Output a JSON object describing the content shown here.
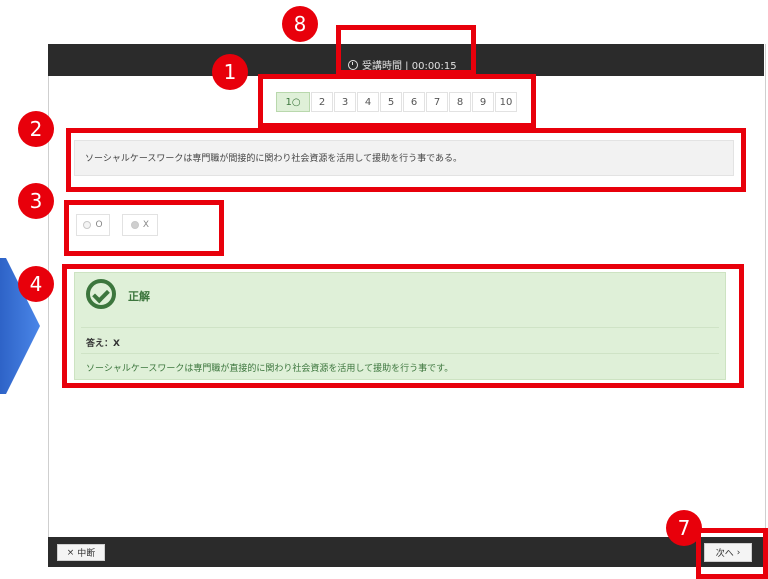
{
  "timer": {
    "label": "受講時間 | 00:00:15"
  },
  "pager": {
    "items": [
      "1○",
      "2",
      "3",
      "4",
      "5",
      "6",
      "7",
      "8",
      "9",
      "10"
    ],
    "active_index": 0
  },
  "question": {
    "text": "ソーシャルケースワークは専門職が間接的に関わり社会資源を活用して援助を行う事である。"
  },
  "options": [
    {
      "label": "O",
      "selected": false
    },
    {
      "label": "X",
      "selected": true
    }
  ],
  "result": {
    "status": "正解",
    "answer": "答え：X",
    "explanation": "ソーシャルケースワークは専門職が直接的に関わり社会資源を活用して援助を行う事です。"
  },
  "footer": {
    "stop_label": "中断",
    "stop_icon": "×",
    "next_label": "次へ",
    "next_icon": "›"
  },
  "annotations": {
    "b1": "1",
    "b2": "2",
    "b3": "3",
    "b4": "4",
    "b7": "7",
    "b8": "8"
  },
  "colors": {
    "accent_red": "#e8000b",
    "correct_green": "#3c763d",
    "correct_bg": "#dff0d8",
    "bar": "#2b2b2b"
  },
  "icons": {
    "timer": "clock-icon",
    "result": "check-circle-icon"
  }
}
